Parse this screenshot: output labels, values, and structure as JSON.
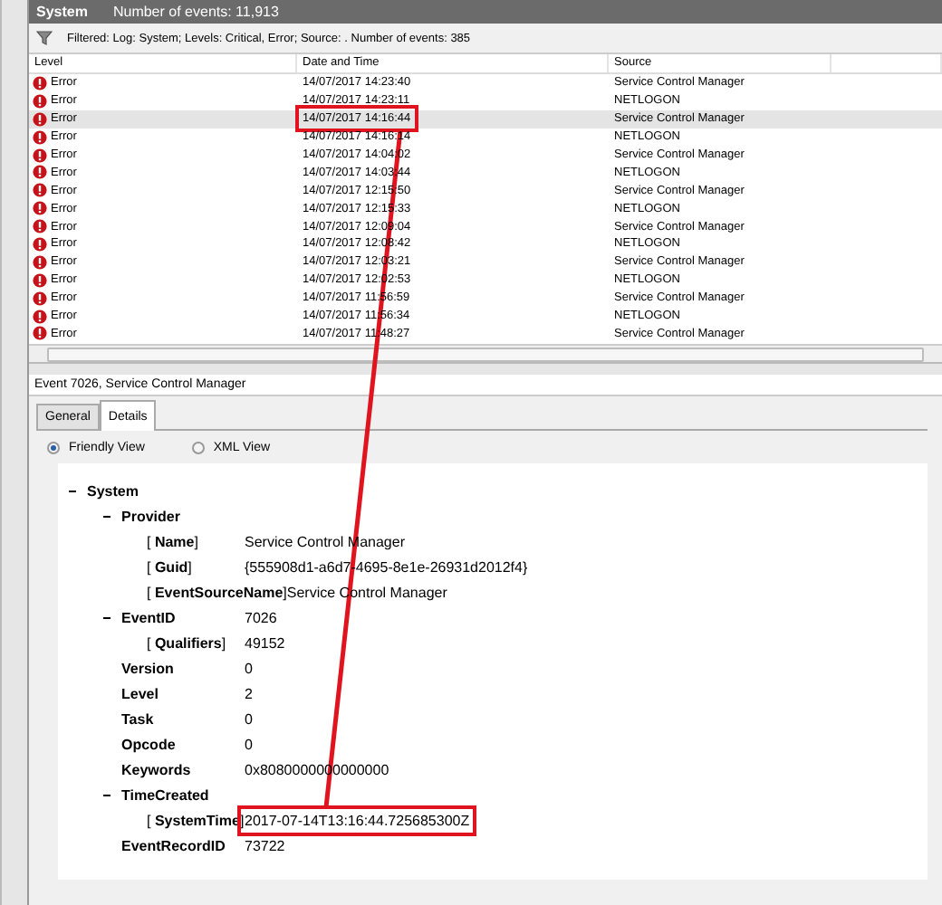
{
  "window": {
    "title": "System",
    "event_count": "Number of events: 11,913"
  },
  "filter": {
    "text": "Filtered: Log: System; Levels: Critical, Error; Source: . Number of events: 385"
  },
  "table": {
    "columns": [
      "Level",
      "Date and Time",
      "Source"
    ],
    "rows": [
      {
        "level": "Error",
        "date": "14/07/2017 14:23:40",
        "source": "Service Control Manager",
        "selected": false,
        "highlighted": false
      },
      {
        "level": "Error",
        "date": "14/07/2017 14:23:11",
        "source": "NETLOGON",
        "selected": false,
        "highlighted": false
      },
      {
        "level": "Error",
        "date": "14/07/2017 14:16:44",
        "source": "Service Control Manager",
        "selected": true,
        "highlighted": true
      },
      {
        "level": "Error",
        "date": "14/07/2017 14:16:14",
        "source": "NETLOGON",
        "selected": false,
        "highlighted": false
      },
      {
        "level": "Error",
        "date": "14/07/2017 14:04:02",
        "source": "Service Control Manager",
        "selected": false,
        "highlighted": false
      },
      {
        "level": "Error",
        "date": "14/07/2017 14:03:44",
        "source": "NETLOGON",
        "selected": false,
        "highlighted": false
      },
      {
        "level": "Error",
        "date": "14/07/2017 12:15:50",
        "source": "Service Control Manager",
        "selected": false,
        "highlighted": false
      },
      {
        "level": "Error",
        "date": "14/07/2017 12:15:33",
        "source": "NETLOGON",
        "selected": false,
        "highlighted": false
      },
      {
        "level": "Error",
        "date": "14/07/2017 12:09:04",
        "source": "Service Control Manager",
        "selected": false,
        "highlighted": false
      },
      {
        "level": "Error",
        "date": "14/07/2017 12:08:42",
        "source": "NETLOGON",
        "selected": false,
        "highlighted": false
      },
      {
        "level": "Error",
        "date": "14/07/2017 12:03:21",
        "source": "Service Control Manager",
        "selected": false,
        "highlighted": false
      },
      {
        "level": "Error",
        "date": "14/07/2017 12:02:53",
        "source": "NETLOGON",
        "selected": false,
        "highlighted": false
      },
      {
        "level": "Error",
        "date": "14/07/2017 11:56:59",
        "source": "Service Control Manager",
        "selected": false,
        "highlighted": false
      },
      {
        "level": "Error",
        "date": "14/07/2017 11:56:34",
        "source": "NETLOGON",
        "selected": false,
        "highlighted": false
      },
      {
        "level": "Error",
        "date": "14/07/2017 11:48:27",
        "source": "Service Control Manager",
        "selected": false,
        "highlighted": false
      }
    ]
  },
  "event": {
    "title": "Event 7026, Service Control Manager",
    "tabs": [
      {
        "label": "General",
        "selected": false
      },
      {
        "label": "Details",
        "selected": true
      }
    ],
    "views": [
      {
        "label": "Friendly View",
        "selected": true
      },
      {
        "label": "XML View",
        "selected": false
      }
    ],
    "tree": {
      "name": "System",
      "expanded": true,
      "children": [
        {
          "name": "Provider",
          "expanded": true,
          "attributes": [
            {
              "name": "[ **Name**]",
              "value": "Service Control Manager",
              "highlighted": false
            },
            {
              "name": "[ **Guid**]",
              "value": "{555908d1-a6d7-4695-8e1e-26931d2012f4}",
              "highlighted": false
            },
            {
              "name": "[ **EventSourceName**]",
              "value": "Service Control Manager",
              "highlighted": false
            }
          ]
        },
        {
          "name": "EventID",
          "value": "7026",
          "expanded": true,
          "attributes": [
            {
              "name": "[ **Qualifiers**]",
              "value": "49152",
              "highlighted": false
            }
          ]
        },
        {
          "name": "Version",
          "value": "0"
        },
        {
          "name": "Level",
          "value": "2"
        },
        {
          "name": "Task",
          "value": "0"
        },
        {
          "name": "Opcode",
          "value": "0"
        },
        {
          "name": "Keywords",
          "value": "0x8080000000000000"
        },
        {
          "name": "TimeCreated",
          "expanded": true,
          "attributes": [
            {
              "name": "[ **SystemTime**]",
              "value": "2017-07-14T13:16:44.725685300Z",
              "highlighted": true
            }
          ]
        },
        {
          "name": "EventRecordID",
          "value": "73722"
        }
      ]
    }
  }
}
